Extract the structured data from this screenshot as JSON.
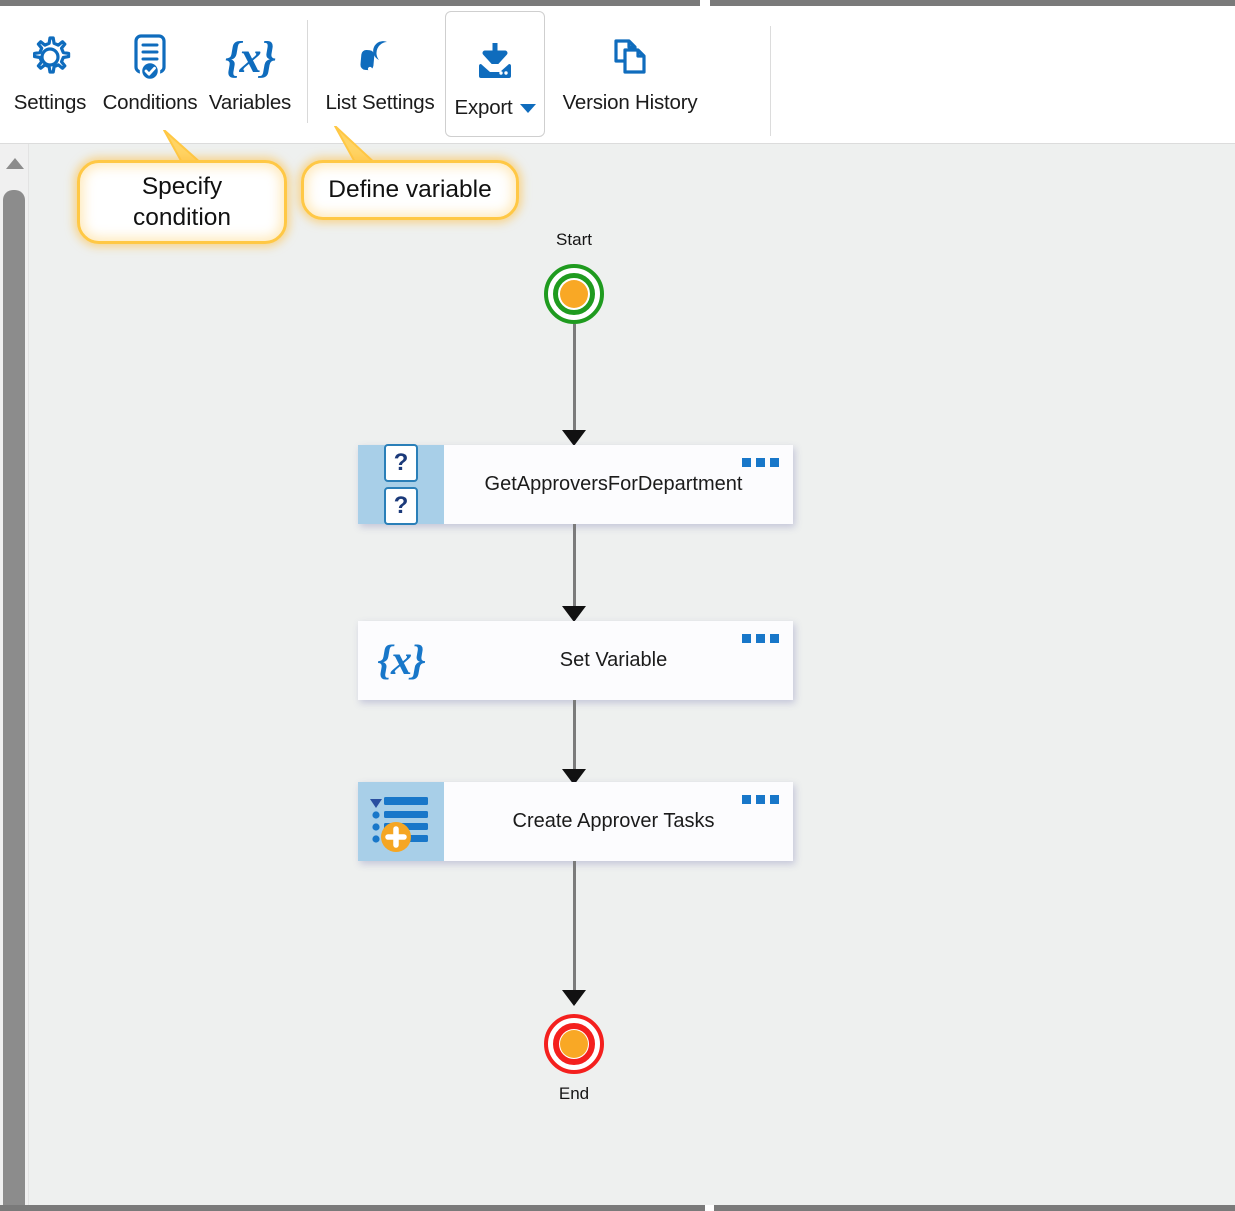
{
  "toolbar": {
    "buttons": [
      {
        "id": "settings",
        "label": "Settings",
        "icon": "gear-icon",
        "active": false
      },
      {
        "id": "conditions",
        "label": "Conditions",
        "icon": "document-check-icon",
        "active": false
      },
      {
        "id": "variables",
        "label": "Variables",
        "icon": "braces-x-icon",
        "active": false
      },
      {
        "id": "list-settings",
        "label": "List Settings",
        "icon": "wrench-icon",
        "active": false
      },
      {
        "id": "export",
        "label": "Export",
        "icon": "download-tray-icon",
        "active": true,
        "has_dropdown": true
      },
      {
        "id": "version-history",
        "label": "Version History",
        "icon": "copy-pages-icon",
        "active": false
      }
    ]
  },
  "callouts": [
    {
      "id": "specify-condition",
      "text": "Specify\ncondition",
      "line1": "Specify",
      "line2": "condition"
    },
    {
      "id": "define-variable",
      "text": "Define variable",
      "line1": "Define variable",
      "line2": ""
    }
  ],
  "flow": {
    "start": {
      "label": "Start",
      "ring_color": "#1f9b1f",
      "core_color": "#f9a825"
    },
    "end": {
      "label": "End",
      "ring_color": "#f4201e",
      "core_color": "#f9a825"
    },
    "nodes": [
      {
        "id": "get-approvers",
        "title": "GetApproversForDepartment",
        "icon": "question-boxes-icon",
        "icon_panel": true
      },
      {
        "id": "set-variable",
        "title": "Set Variable",
        "icon": "braces-x-icon",
        "icon_panel": false
      },
      {
        "id": "create-approver-tasks",
        "title": "Create Approver Tasks",
        "icon": "list-add-icon",
        "icon_panel": true
      }
    ],
    "menu_glyph": "..."
  },
  "colors": {
    "accent_blue": "#0f6cbd",
    "node_icon_panel": "#a8cfe8",
    "canvas_bg": "#eef0ef",
    "callout_border": "#ffc845",
    "orange": "#f9a825",
    "start_green": "#1f9b1f",
    "end_red": "#f4201e"
  }
}
